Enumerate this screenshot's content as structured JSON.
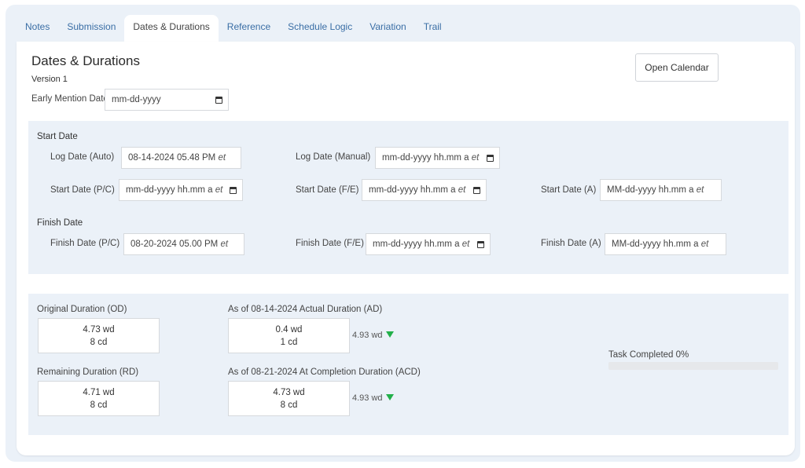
{
  "tabs": [
    {
      "label": "Notes",
      "active": false
    },
    {
      "label": "Submission",
      "active": false
    },
    {
      "label": "Dates & Durations",
      "active": true
    },
    {
      "label": "Reference",
      "active": false
    },
    {
      "label": "Schedule Logic",
      "active": false
    },
    {
      "label": "Variation",
      "active": false
    },
    {
      "label": "Trail",
      "active": false
    }
  ],
  "header": {
    "title": "Dates & Durations",
    "version": "Version 1",
    "open_calendar_label": "Open Calendar",
    "early_mention": {
      "label": "Early Mention Date:",
      "placeholder": "mm-dd-yyyy"
    }
  },
  "start_section": {
    "label": "Start Date",
    "log_auto": {
      "label": "Log Date (Auto)",
      "value": "08-14-2024 05.48 PM",
      "tz": "et"
    },
    "log_manual": {
      "label": "Log Date (Manual)",
      "placeholder": "mm-dd-yyyy hh.mm a",
      "tz": "et"
    },
    "start_pc": {
      "label": "Start Date (P/C)",
      "placeholder": "mm-dd-yyyy hh.mm a",
      "tz": "et"
    },
    "start_fe": {
      "label": "Start Date (F/E)",
      "placeholder": "mm-dd-yyyy hh.mm a",
      "tz": "et"
    },
    "start_a": {
      "label": "Start Date (A)",
      "placeholder": "MM-dd-yyyy hh.mm a",
      "tz": "et"
    }
  },
  "finish_section": {
    "label": "Finish Date",
    "finish_pc": {
      "label": "Finish Date (P/C)",
      "value": "08-20-2024 05.00 PM",
      "tz": "et"
    },
    "finish_fe": {
      "label": "Finish Date (F/E)",
      "placeholder": "mm-dd-yyyy hh.mm a",
      "tz": "et"
    },
    "finish_a": {
      "label": "Finish Date (A)",
      "placeholder": "MM-dd-yyyy hh.mm a",
      "tz": "et"
    }
  },
  "durations": {
    "od": {
      "label": "Original Duration (OD)",
      "wd": "4.73 wd",
      "cd": "8 cd"
    },
    "ad": {
      "label": "As of 08-14-2024 Actual Duration (AD)",
      "wd": "0.4 wd",
      "cd": "1 cd",
      "delta": "4.93 wd",
      "trend": "down"
    },
    "rd": {
      "label": "Remaining Duration (RD)",
      "wd": "4.71 wd",
      "cd": "8 cd"
    },
    "acd": {
      "label": "As of 08-21-2024 At Completion Duration (ACD)",
      "wd": "4.73 wd",
      "cd": "8 cd",
      "delta": "4.93 wd",
      "trend": "down"
    }
  },
  "progress": {
    "label": "Task Completed 0%",
    "percent": 0
  },
  "colors": {
    "accent": "#3a6ea5",
    "panel": "#ebf1f8",
    "trend_down": "#22b04a"
  }
}
